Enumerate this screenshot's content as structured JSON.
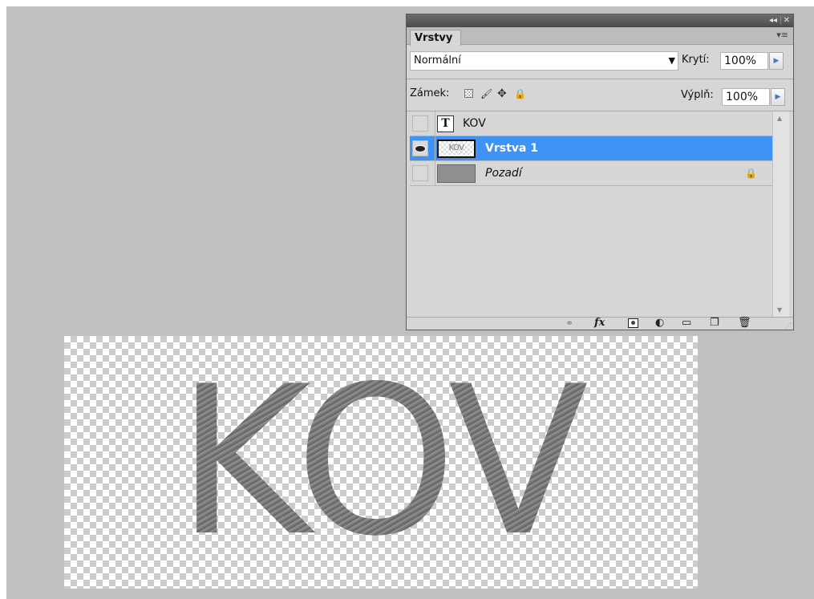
{
  "panel": {
    "tab_label": "Vrstvy",
    "window_controls": {
      "collapse": "◂◂",
      "separator": "|",
      "close": "✕"
    },
    "menu_icon": "panel-menu-icon",
    "blend_mode": "Normální",
    "opacity_label": "Krytí:",
    "opacity_value": "100%",
    "lock_label": "Zámek:",
    "lock_icons": [
      "lock-transparent-icon",
      "lock-brush-icon",
      "lock-move-icon",
      "lock-all-icon"
    ],
    "fill_label": "Výplň:",
    "fill_value": "100%",
    "layers": [
      {
        "name": "KOV",
        "kind": "type",
        "thumb_glyph": "T",
        "visible": false,
        "selected": false
      },
      {
        "name": "Vrstva 1",
        "kind": "raster",
        "thumb_text": "KOV",
        "visible": true,
        "selected": true
      },
      {
        "name": "Pozadí",
        "kind": "background",
        "visible": false,
        "selected": false,
        "locked": true
      }
    ],
    "footer_icons": [
      "link-icon",
      "fx-icon",
      "mask-icon",
      "adjustment-icon",
      "folder-icon",
      "new-layer-icon",
      "trash-icon"
    ],
    "fx_label": "fx"
  },
  "canvas": {
    "text": "KOV",
    "text_color": "#6d6d6d",
    "selection_color": "#3f93f4"
  }
}
